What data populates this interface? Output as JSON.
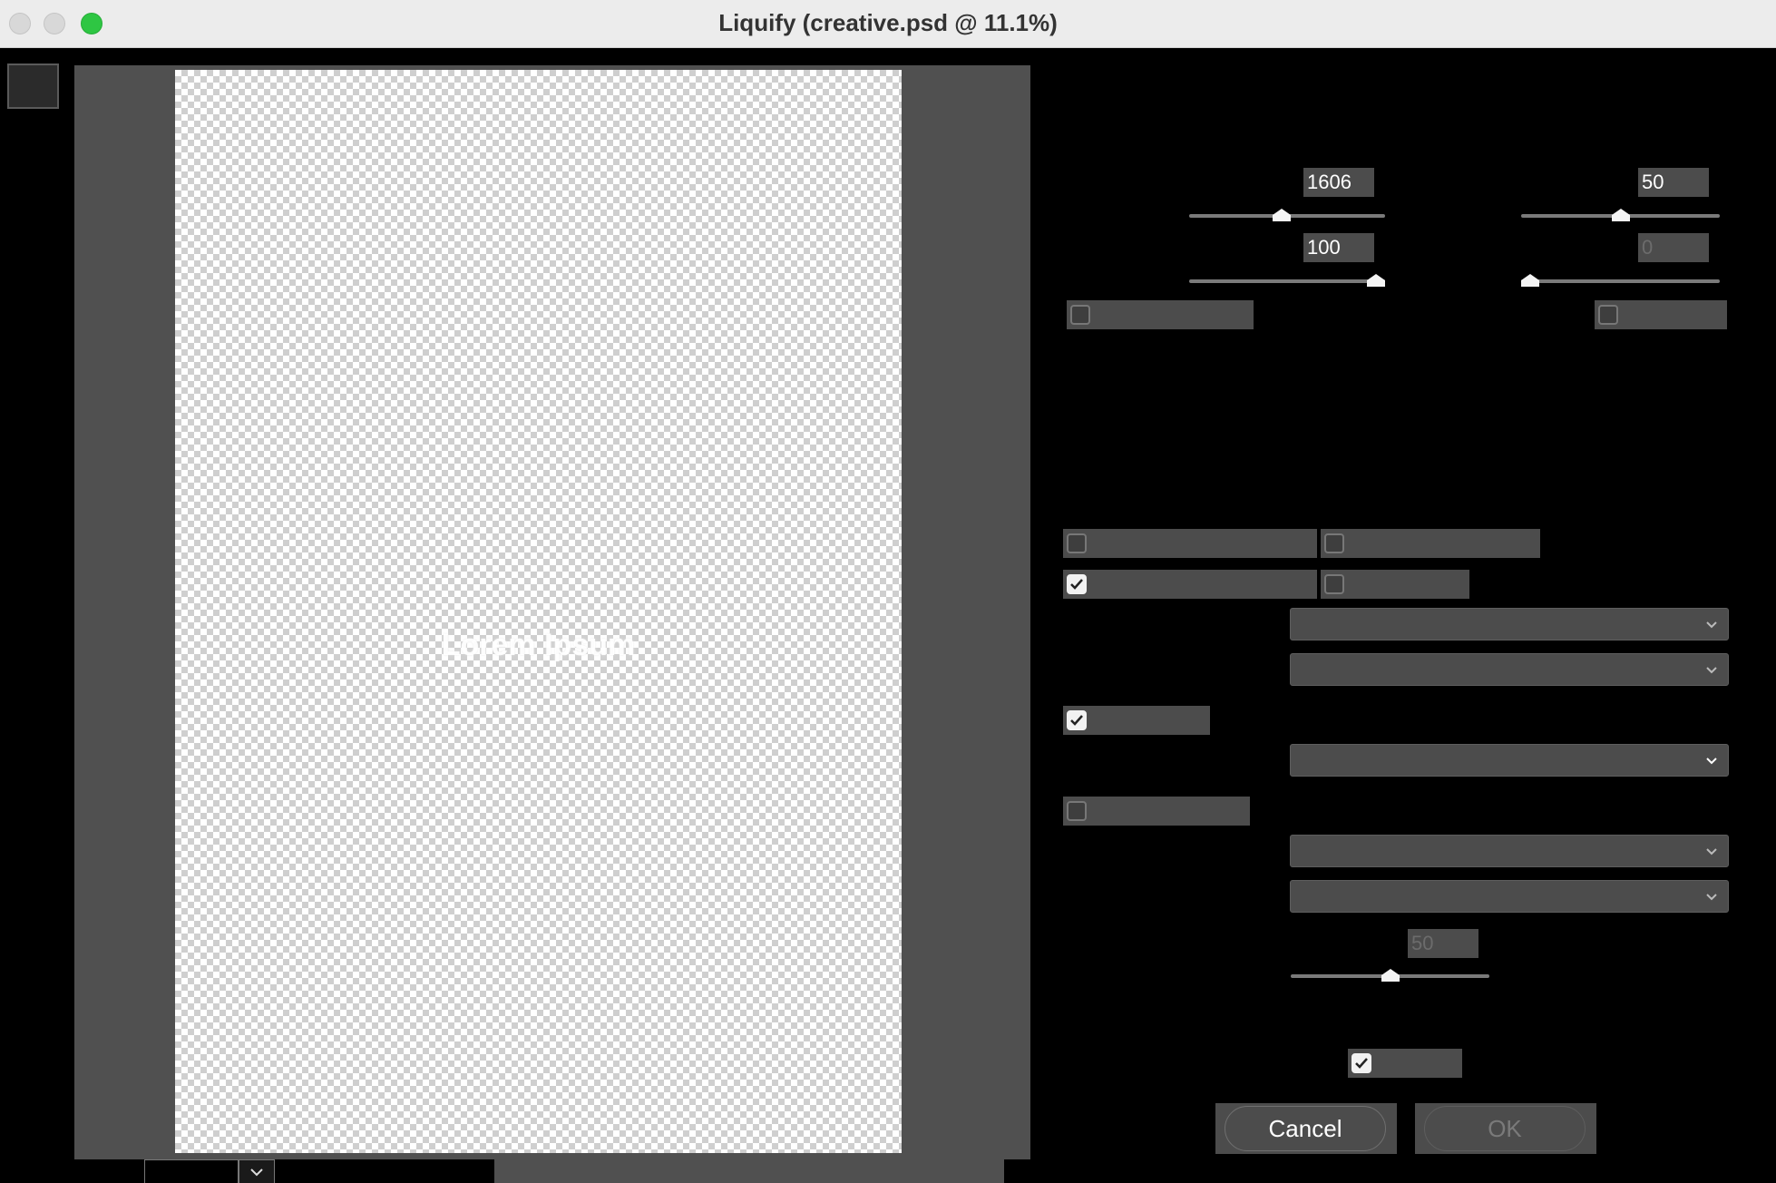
{
  "window": {
    "title": "Liquify (creative.psd @ 11.1%)"
  },
  "canvas": {
    "text": "Lorem Ipsum"
  },
  "brush": {
    "size": {
      "value": "1606",
      "level": 0.47
    },
    "density": {
      "value": "50",
      "level": 0.5
    },
    "pressure": {
      "value": "100",
      "level": 1.0
    },
    "rate": {
      "value": "0",
      "level": 0.0
    }
  },
  "checkboxes": {
    "row1_left": false,
    "row1_right": false,
    "a1": false,
    "a2": false,
    "b1": true,
    "b2": false,
    "c1": true,
    "d1": false,
    "preview": true
  },
  "mask_opacity": {
    "value": "50",
    "level": 0.5
  },
  "buttons": {
    "cancel": "Cancel",
    "ok": "OK"
  },
  "icons": {
    "dropdown": "chevron-down-icon",
    "check": "checkmark-icon"
  }
}
